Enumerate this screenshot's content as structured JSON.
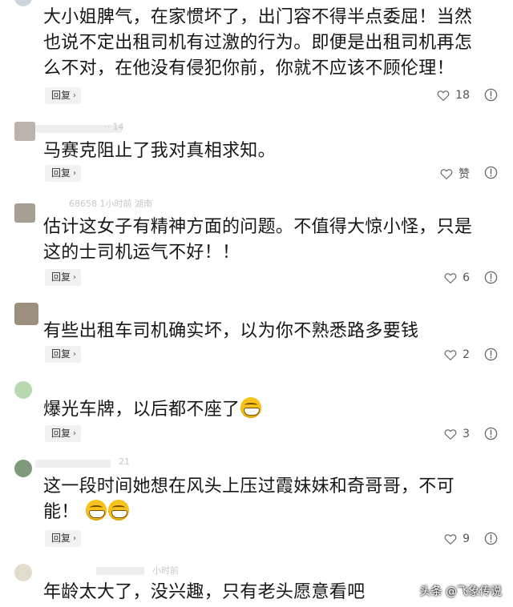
{
  "comments": [
    {
      "text": "大小姐脾气，在家惯坏了，出门容不得半点委屈！当然\n也说不定出租司机有过激的行为。即便是出租司机再怎\n么不对，在他没有侵犯你前，你就不应该不顾伦理！",
      "meta": "",
      "reply": "回复",
      "likes": "18"
    },
    {
      "text": "马赛克阻止了我对真相求知。",
      "meta": "·· 14",
      "reply": "回复",
      "likes": "赞"
    },
    {
      "text": "估计这女子有精神方面的问题。不值得大惊小怪，只是\n这的士司机运气不好！！",
      "meta": "68658  1小时前  湖南",
      "reply": "回复",
      "likes": "6"
    },
    {
      "text": "有些出租车司机确实坏，以为你不熟悉路多要钱",
      "meta": "",
      "reply": "回复",
      "likes": "2"
    },
    {
      "text": "爆光车牌，以后都不座了",
      "meta": "",
      "reply": "回复",
      "likes": "3"
    },
    {
      "text": "这一段时间她想在风头上压过霞妹妹和奇哥哥，不可\n能！",
      "meta": "21",
      "reply": "回复",
      "likes": "9"
    },
    {
      "text": "年龄太大了，没兴趣，只有老头愿意看吧",
      "meta": "小时前",
      "reply": "",
      "likes": ""
    }
  ],
  "watermark": "头条 @飞象传说",
  "icons": {
    "like": "heart-outline-icon",
    "report": "report-icon",
    "emoji": "grin-emoji-icon",
    "chevron": "chevron-right-icon"
  },
  "colors": {
    "text": "#161616",
    "meta": "#c8c8c8",
    "reply_bg": "#f1f1f1",
    "emoji": "#f6c21c"
  }
}
